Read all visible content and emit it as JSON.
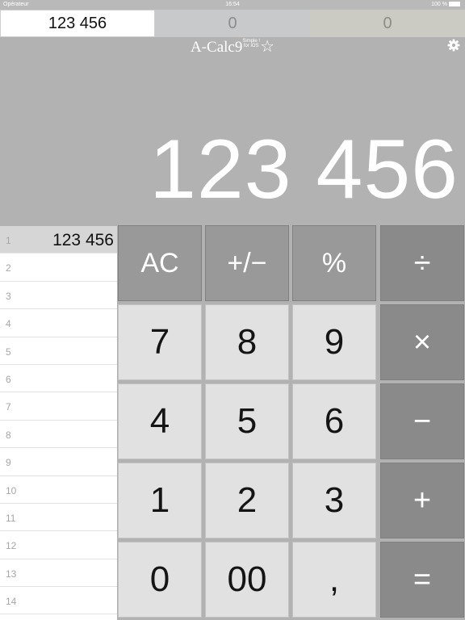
{
  "status_bar": {
    "carrier": "Opérateur",
    "time": "16:54",
    "battery": "100 %"
  },
  "memory_tabs": [
    "123 456",
    "0",
    "0"
  ],
  "brand": {
    "name": "A-Calc9",
    "sub_top": "Simple !",
    "sub_bottom": "for iOS",
    "star": "☆"
  },
  "display": {
    "value": "123 456"
  },
  "history": {
    "rows": [
      {
        "num": "1",
        "val": "123 456"
      },
      {
        "num": "2",
        "val": ""
      },
      {
        "num": "3",
        "val": ""
      },
      {
        "num": "4",
        "val": ""
      },
      {
        "num": "5",
        "val": ""
      },
      {
        "num": "6",
        "val": ""
      },
      {
        "num": "7",
        "val": ""
      },
      {
        "num": "8",
        "val": ""
      },
      {
        "num": "9",
        "val": ""
      },
      {
        "num": "10",
        "val": ""
      },
      {
        "num": "11",
        "val": ""
      },
      {
        "num": "12",
        "val": ""
      },
      {
        "num": "13",
        "val": ""
      },
      {
        "num": "14",
        "val": ""
      }
    ]
  },
  "keys": {
    "ac": "AC",
    "sign": "+/−",
    "percent": "%",
    "divide": "÷",
    "k7": "7",
    "k8": "8",
    "k9": "9",
    "multiply": "×",
    "k4": "4",
    "k5": "5",
    "k6": "6",
    "minus": "−",
    "k1": "1",
    "k2": "2",
    "k3": "3",
    "plus": "+",
    "k0": "0",
    "k00": "00",
    "comma": ",",
    "equals": "="
  },
  "colors": {
    "background": "#b2b2b2",
    "function_key": "#999999",
    "number_key": "#e1e1e1",
    "operator_key": "#8a8a8a"
  }
}
